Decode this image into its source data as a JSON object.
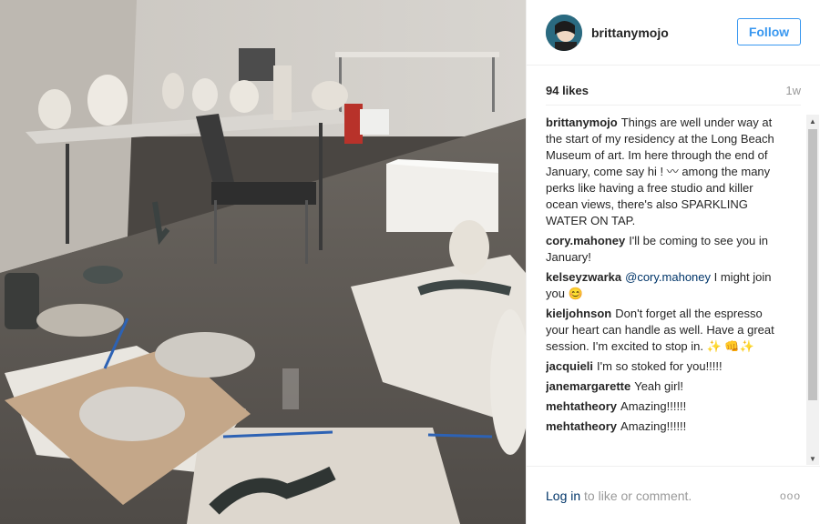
{
  "post": {
    "username": "brittanymojo",
    "follow_label": "Follow",
    "likes": "94 likes",
    "age": "1w",
    "more_icon": "ooo",
    "login_link": "Log in",
    "login_rest": " to like or comment."
  },
  "comments": [
    {
      "user": "brittanymojo",
      "text": "Things are well under way at the start of my residency at the Long Beach Museum of art. Im here through the end of January, come say hi ! 〰 among the many perks like having a free studio and killer ocean views, there's also SPARKLING WATER ON TAP."
    },
    {
      "user": "cory.mahoney",
      "text": "I'll be coming to see you in January!"
    },
    {
      "user": "kelseyzwarka",
      "mention": "@cory.mahoney",
      "text": " I might join you 😊"
    },
    {
      "user": "kieljohnson",
      "text": "Don't forget all the espresso your heart can handle as well. Have a great session. I'm excited to stop in. ✨ 👊✨"
    },
    {
      "user": "jacquieli",
      "text": "I'm so stoked for you!!!!!"
    },
    {
      "user": "janemargarette",
      "text": "Yeah girl!"
    },
    {
      "user": "mehtatheory",
      "text": "Amazing!!!!!!"
    },
    {
      "user": "mehtatheory",
      "text": "Amazing!!!!!!"
    }
  ],
  "icons": {
    "avatar": "profile-avatar",
    "scroll_up": "▲",
    "scroll_down": "▼"
  }
}
